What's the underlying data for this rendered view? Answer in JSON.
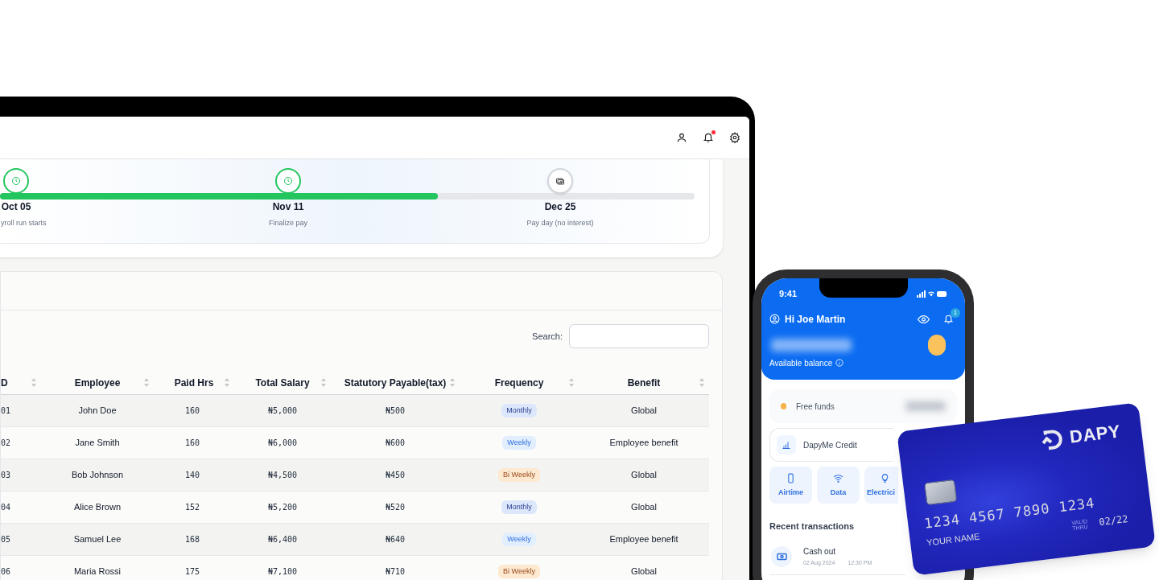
{
  "laptop": {
    "header": {
      "notification_unread": true
    },
    "timeline": {
      "level": 0.63,
      "milestones": [
        {
          "date": "Oct 05",
          "label": "yroll run starts",
          "reached": true
        },
        {
          "date": "Nov 11",
          "label": "Finalize pay",
          "reached": true
        },
        {
          "date": "Dec 25",
          "label": "Pay day (no interest)",
          "reached": false
        }
      ]
    },
    "table": {
      "search_label": "Search:",
      "columns": [
        "D",
        "Employee",
        "Paid Hrs",
        "Total Salary",
        "Statutory Payable(tax)",
        "Frequency",
        "Benefit"
      ],
      "rows": [
        {
          "id": "01",
          "employee": "John Doe",
          "paid_hrs": "160",
          "total_salary": "₦5,000",
          "tax": "₦500",
          "frequency": {
            "text": "Monthly",
            "kind": "monthly"
          },
          "benefit": "Global"
        },
        {
          "id": "02",
          "employee": "Jane Smith",
          "paid_hrs": "160",
          "total_salary": "₦6,000",
          "tax": "₦600",
          "frequency": {
            "text": "Weekly",
            "kind": "weekly"
          },
          "benefit": "Employee benefit"
        },
        {
          "id": "03",
          "employee": "Bob Johnson",
          "paid_hrs": "140",
          "total_salary": "₦4,500",
          "tax": "₦450",
          "frequency": {
            "text": "Bi Weekly",
            "kind": "biweekly"
          },
          "benefit": "Global"
        },
        {
          "id": "04",
          "employee": "Alice Brown",
          "paid_hrs": "152",
          "total_salary": "₦5,200",
          "tax": "₦520",
          "frequency": {
            "text": "Monthly",
            "kind": "monthly"
          },
          "benefit": "Global"
        },
        {
          "id": "05",
          "employee": "Samuel Lee",
          "paid_hrs": "168",
          "total_salary": "₦6,400",
          "tax": "₦640",
          "frequency": {
            "text": "Weekly",
            "kind": "weekly"
          },
          "benefit": "Employee benefit"
        },
        {
          "id": "06",
          "employee": "Maria Rossi",
          "paid_hrs": "175",
          "total_salary": "₦7,100",
          "tax": "₦710",
          "frequency": {
            "text": "Bi Weekly",
            "kind": "biweekly"
          },
          "benefit": "Global"
        }
      ]
    }
  },
  "phone": {
    "status_time": "9:41",
    "greeting": "Hi Joe Martin",
    "notification_count": "1",
    "balance_label": "Available balance",
    "free_funds": "Free funds",
    "credit": "DapyMe Credit",
    "tiles": [
      {
        "label": "Airtime"
      },
      {
        "label": "Data"
      },
      {
        "label": "Electrici"
      }
    ],
    "recent_title": "Recent transactions",
    "transactions": [
      {
        "title": "Cash out",
        "date": "02 Aug 2024",
        "time": "12:30 PM"
      }
    ]
  },
  "bank_card": {
    "brand": "DAPY",
    "number": "1234 4567 7890 1234",
    "valid_label": "VALID THRU",
    "expiry": "02/22",
    "holder": "YOUR NAME"
  }
}
